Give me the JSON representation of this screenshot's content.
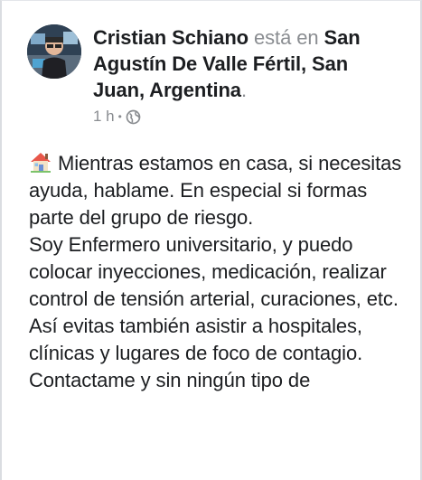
{
  "post": {
    "author": "Cristian Schiano",
    "verb": "está en",
    "location": "San Agustín De Valle Fértil, San Juan, Argentina",
    "period": ".",
    "timestamp": "1 h",
    "separator": "•",
    "audience_icon": "globe-icon",
    "body_icon": "house-icon",
    "lines": [
      "Mientras estamos en casa, si necesitas ayuda, hablame. En especial si formas parte del grupo de riesgo.",
      "Soy Enfermero universitario, y puedo colocar inyecciones, medicación, realizar control de tensión arterial, curaciones, etc.",
      "Así evitas también asistir a hospitales, clínicas y lugares de foco de contagio.",
      "Contactame y sin ningún tipo de"
    ]
  },
  "colors": {
    "text": "#1c1e21",
    "meta": "#8a8d91",
    "border": "#dadde1"
  }
}
